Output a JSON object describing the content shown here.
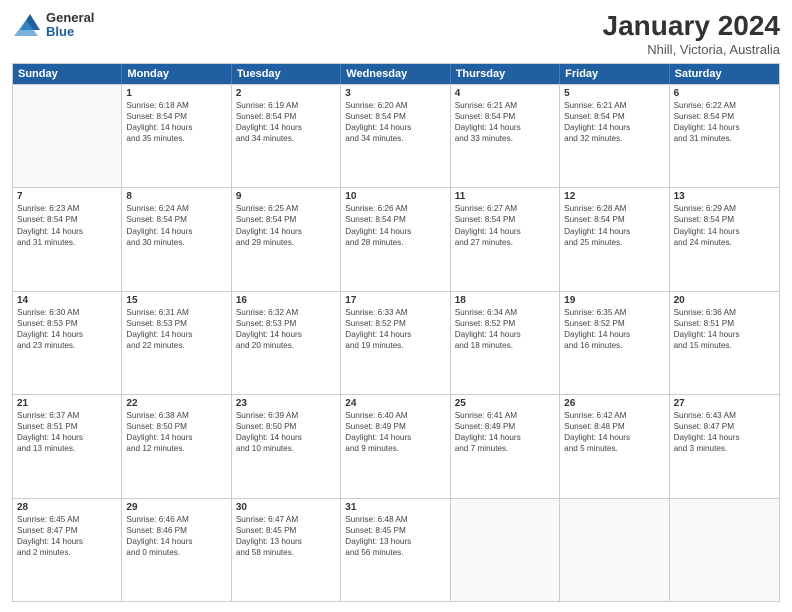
{
  "logo": {
    "general": "General",
    "blue": "Blue"
  },
  "title": "January 2024",
  "subtitle": "Nhill, Victoria, Australia",
  "headers": [
    "Sunday",
    "Monday",
    "Tuesday",
    "Wednesday",
    "Thursday",
    "Friday",
    "Saturday"
  ],
  "rows": [
    [
      {
        "day": "",
        "info": ""
      },
      {
        "day": "1",
        "info": "Sunrise: 6:18 AM\nSunset: 8:54 PM\nDaylight: 14 hours\nand 35 minutes."
      },
      {
        "day": "2",
        "info": "Sunrise: 6:19 AM\nSunset: 8:54 PM\nDaylight: 14 hours\nand 34 minutes."
      },
      {
        "day": "3",
        "info": "Sunrise: 6:20 AM\nSunset: 8:54 PM\nDaylight: 14 hours\nand 34 minutes."
      },
      {
        "day": "4",
        "info": "Sunrise: 6:21 AM\nSunset: 8:54 PM\nDaylight: 14 hours\nand 33 minutes."
      },
      {
        "day": "5",
        "info": "Sunrise: 6:21 AM\nSunset: 8:54 PM\nDaylight: 14 hours\nand 32 minutes."
      },
      {
        "day": "6",
        "info": "Sunrise: 6:22 AM\nSunset: 8:54 PM\nDaylight: 14 hours\nand 31 minutes."
      }
    ],
    [
      {
        "day": "7",
        "info": "Sunrise: 6:23 AM\nSunset: 8:54 PM\nDaylight: 14 hours\nand 31 minutes."
      },
      {
        "day": "8",
        "info": "Sunrise: 6:24 AM\nSunset: 8:54 PM\nDaylight: 14 hours\nand 30 minutes."
      },
      {
        "day": "9",
        "info": "Sunrise: 6:25 AM\nSunset: 8:54 PM\nDaylight: 14 hours\nand 29 minutes."
      },
      {
        "day": "10",
        "info": "Sunrise: 6:26 AM\nSunset: 8:54 PM\nDaylight: 14 hours\nand 28 minutes."
      },
      {
        "day": "11",
        "info": "Sunrise: 6:27 AM\nSunset: 8:54 PM\nDaylight: 14 hours\nand 27 minutes."
      },
      {
        "day": "12",
        "info": "Sunrise: 6:28 AM\nSunset: 8:54 PM\nDaylight: 14 hours\nand 25 minutes."
      },
      {
        "day": "13",
        "info": "Sunrise: 6:29 AM\nSunset: 8:54 PM\nDaylight: 14 hours\nand 24 minutes."
      }
    ],
    [
      {
        "day": "14",
        "info": "Sunrise: 6:30 AM\nSunset: 8:53 PM\nDaylight: 14 hours\nand 23 minutes."
      },
      {
        "day": "15",
        "info": "Sunrise: 6:31 AM\nSunset: 8:53 PM\nDaylight: 14 hours\nand 22 minutes."
      },
      {
        "day": "16",
        "info": "Sunrise: 6:32 AM\nSunset: 8:53 PM\nDaylight: 14 hours\nand 20 minutes."
      },
      {
        "day": "17",
        "info": "Sunrise: 6:33 AM\nSunset: 8:52 PM\nDaylight: 14 hours\nand 19 minutes."
      },
      {
        "day": "18",
        "info": "Sunrise: 6:34 AM\nSunset: 8:52 PM\nDaylight: 14 hours\nand 18 minutes."
      },
      {
        "day": "19",
        "info": "Sunrise: 6:35 AM\nSunset: 8:52 PM\nDaylight: 14 hours\nand 16 minutes."
      },
      {
        "day": "20",
        "info": "Sunrise: 6:36 AM\nSunset: 8:51 PM\nDaylight: 14 hours\nand 15 minutes."
      }
    ],
    [
      {
        "day": "21",
        "info": "Sunrise: 6:37 AM\nSunset: 8:51 PM\nDaylight: 14 hours\nand 13 minutes."
      },
      {
        "day": "22",
        "info": "Sunrise: 6:38 AM\nSunset: 8:50 PM\nDaylight: 14 hours\nand 12 minutes."
      },
      {
        "day": "23",
        "info": "Sunrise: 6:39 AM\nSunset: 8:50 PM\nDaylight: 14 hours\nand 10 minutes."
      },
      {
        "day": "24",
        "info": "Sunrise: 6:40 AM\nSunset: 8:49 PM\nDaylight: 14 hours\nand 9 minutes."
      },
      {
        "day": "25",
        "info": "Sunrise: 6:41 AM\nSunset: 8:49 PM\nDaylight: 14 hours\nand 7 minutes."
      },
      {
        "day": "26",
        "info": "Sunrise: 6:42 AM\nSunset: 8:48 PM\nDaylight: 14 hours\nand 5 minutes."
      },
      {
        "day": "27",
        "info": "Sunrise: 6:43 AM\nSunset: 8:47 PM\nDaylight: 14 hours\nand 3 minutes."
      }
    ],
    [
      {
        "day": "28",
        "info": "Sunrise: 6:45 AM\nSunset: 8:47 PM\nDaylight: 14 hours\nand 2 minutes."
      },
      {
        "day": "29",
        "info": "Sunrise: 6:46 AM\nSunset: 8:46 PM\nDaylight: 14 hours\nand 0 minutes."
      },
      {
        "day": "30",
        "info": "Sunrise: 6:47 AM\nSunset: 8:45 PM\nDaylight: 13 hours\nand 58 minutes."
      },
      {
        "day": "31",
        "info": "Sunrise: 6:48 AM\nSunset: 8:45 PM\nDaylight: 13 hours\nand 56 minutes."
      },
      {
        "day": "",
        "info": ""
      },
      {
        "day": "",
        "info": ""
      },
      {
        "day": "",
        "info": ""
      }
    ]
  ]
}
